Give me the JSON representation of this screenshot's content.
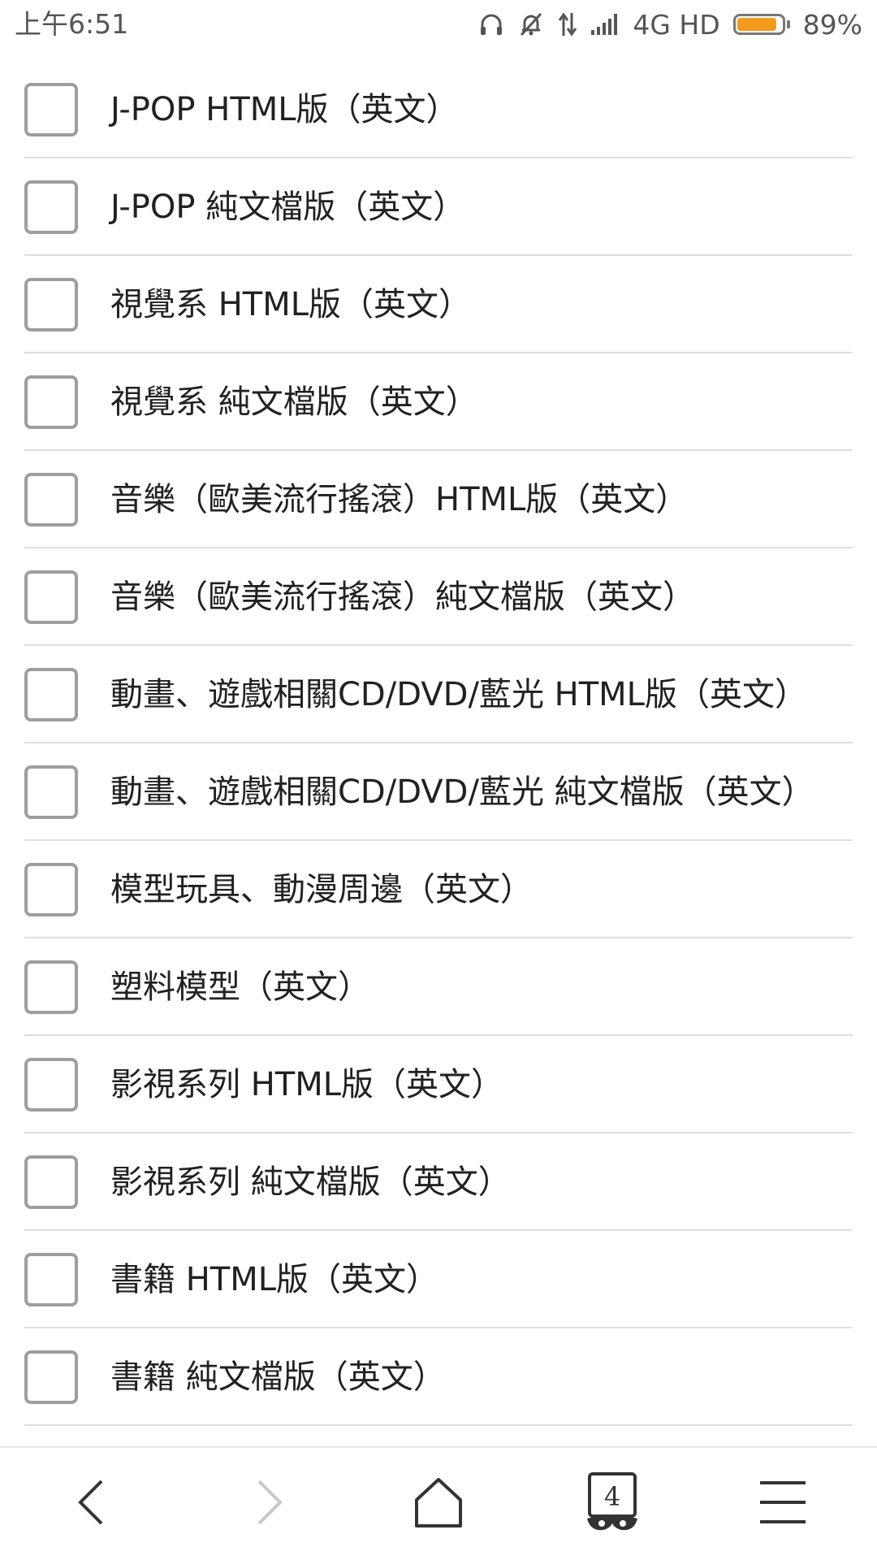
{
  "status_bar": {
    "time": "上午6:51",
    "network": "4G HD",
    "battery_percent": "89%",
    "battery_level": 0.89,
    "battery_color": "#f39a1e"
  },
  "list": {
    "items": [
      {
        "label": "J-POP HTML版（英文）",
        "checked": false
      },
      {
        "label": "J-POP 純文檔版（英文）",
        "checked": false
      },
      {
        "label": "視覺系 HTML版（英文）",
        "checked": false
      },
      {
        "label": "視覺系 純文檔版（英文）",
        "checked": false
      },
      {
        "label": "音樂（歐美流行搖滾）HTML版（英文）",
        "checked": false
      },
      {
        "label": "音樂（歐美流行搖滾）純文檔版（英文）",
        "checked": false
      },
      {
        "label": "動畫、遊戲相關CD/DVD/藍光 HTML版（英文）",
        "checked": false
      },
      {
        "label": "動畫、遊戲相關CD/DVD/藍光 純文檔版（英文）",
        "checked": false
      },
      {
        "label": "模型玩具、動漫周邊（英文）",
        "checked": false
      },
      {
        "label": "塑料模型（英文）",
        "checked": false
      },
      {
        "label": "影視系列 HTML版（英文）",
        "checked": false
      },
      {
        "label": "影視系列 純文檔版（英文）",
        "checked": false
      },
      {
        "label": "書籍 HTML版（英文）",
        "checked": false
      },
      {
        "label": "書籍 純文檔版（英文）",
        "checked": false
      }
    ]
  },
  "bottom_nav": {
    "tab_count": "4",
    "icons": [
      "back-arrow-icon",
      "forward-arrow-icon",
      "home-icon",
      "tabs-incognito-icon",
      "menu-icon"
    ]
  }
}
